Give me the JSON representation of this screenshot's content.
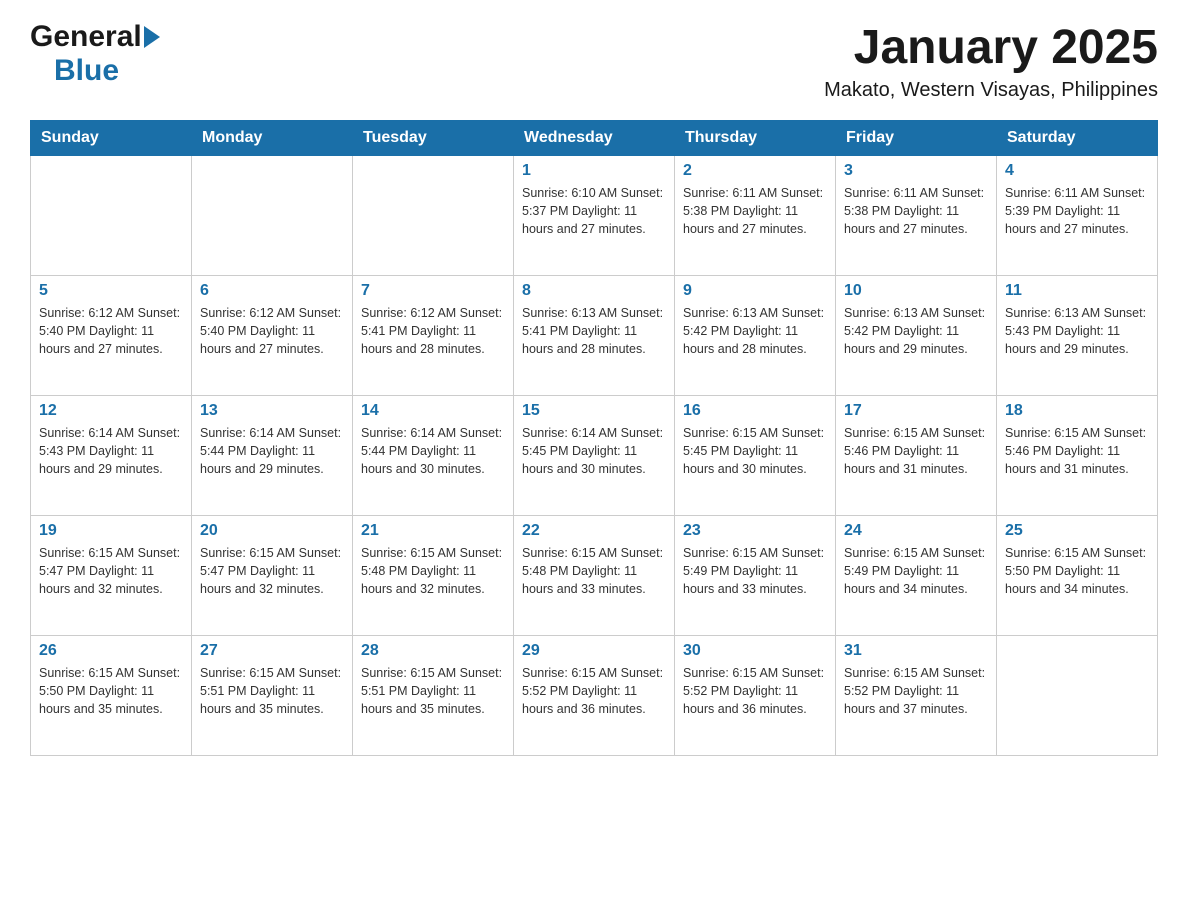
{
  "header": {
    "logo_general": "General",
    "logo_blue": "Blue",
    "month_year": "January 2025",
    "location": "Makato, Western Visayas, Philippines"
  },
  "days_of_week": [
    "Sunday",
    "Monday",
    "Tuesday",
    "Wednesday",
    "Thursday",
    "Friday",
    "Saturday"
  ],
  "weeks": [
    [
      {
        "day": "",
        "info": ""
      },
      {
        "day": "",
        "info": ""
      },
      {
        "day": "",
        "info": ""
      },
      {
        "day": "1",
        "info": "Sunrise: 6:10 AM\nSunset: 5:37 PM\nDaylight: 11 hours\nand 27 minutes."
      },
      {
        "day": "2",
        "info": "Sunrise: 6:11 AM\nSunset: 5:38 PM\nDaylight: 11 hours\nand 27 minutes."
      },
      {
        "day": "3",
        "info": "Sunrise: 6:11 AM\nSunset: 5:38 PM\nDaylight: 11 hours\nand 27 minutes."
      },
      {
        "day": "4",
        "info": "Sunrise: 6:11 AM\nSunset: 5:39 PM\nDaylight: 11 hours\nand 27 minutes."
      }
    ],
    [
      {
        "day": "5",
        "info": "Sunrise: 6:12 AM\nSunset: 5:40 PM\nDaylight: 11 hours\nand 27 minutes."
      },
      {
        "day": "6",
        "info": "Sunrise: 6:12 AM\nSunset: 5:40 PM\nDaylight: 11 hours\nand 27 minutes."
      },
      {
        "day": "7",
        "info": "Sunrise: 6:12 AM\nSunset: 5:41 PM\nDaylight: 11 hours\nand 28 minutes."
      },
      {
        "day": "8",
        "info": "Sunrise: 6:13 AM\nSunset: 5:41 PM\nDaylight: 11 hours\nand 28 minutes."
      },
      {
        "day": "9",
        "info": "Sunrise: 6:13 AM\nSunset: 5:42 PM\nDaylight: 11 hours\nand 28 minutes."
      },
      {
        "day": "10",
        "info": "Sunrise: 6:13 AM\nSunset: 5:42 PM\nDaylight: 11 hours\nand 29 minutes."
      },
      {
        "day": "11",
        "info": "Sunrise: 6:13 AM\nSunset: 5:43 PM\nDaylight: 11 hours\nand 29 minutes."
      }
    ],
    [
      {
        "day": "12",
        "info": "Sunrise: 6:14 AM\nSunset: 5:43 PM\nDaylight: 11 hours\nand 29 minutes."
      },
      {
        "day": "13",
        "info": "Sunrise: 6:14 AM\nSunset: 5:44 PM\nDaylight: 11 hours\nand 29 minutes."
      },
      {
        "day": "14",
        "info": "Sunrise: 6:14 AM\nSunset: 5:44 PM\nDaylight: 11 hours\nand 30 minutes."
      },
      {
        "day": "15",
        "info": "Sunrise: 6:14 AM\nSunset: 5:45 PM\nDaylight: 11 hours\nand 30 minutes."
      },
      {
        "day": "16",
        "info": "Sunrise: 6:15 AM\nSunset: 5:45 PM\nDaylight: 11 hours\nand 30 minutes."
      },
      {
        "day": "17",
        "info": "Sunrise: 6:15 AM\nSunset: 5:46 PM\nDaylight: 11 hours\nand 31 minutes."
      },
      {
        "day": "18",
        "info": "Sunrise: 6:15 AM\nSunset: 5:46 PM\nDaylight: 11 hours\nand 31 minutes."
      }
    ],
    [
      {
        "day": "19",
        "info": "Sunrise: 6:15 AM\nSunset: 5:47 PM\nDaylight: 11 hours\nand 32 minutes."
      },
      {
        "day": "20",
        "info": "Sunrise: 6:15 AM\nSunset: 5:47 PM\nDaylight: 11 hours\nand 32 minutes."
      },
      {
        "day": "21",
        "info": "Sunrise: 6:15 AM\nSunset: 5:48 PM\nDaylight: 11 hours\nand 32 minutes."
      },
      {
        "day": "22",
        "info": "Sunrise: 6:15 AM\nSunset: 5:48 PM\nDaylight: 11 hours\nand 33 minutes."
      },
      {
        "day": "23",
        "info": "Sunrise: 6:15 AM\nSunset: 5:49 PM\nDaylight: 11 hours\nand 33 minutes."
      },
      {
        "day": "24",
        "info": "Sunrise: 6:15 AM\nSunset: 5:49 PM\nDaylight: 11 hours\nand 34 minutes."
      },
      {
        "day": "25",
        "info": "Sunrise: 6:15 AM\nSunset: 5:50 PM\nDaylight: 11 hours\nand 34 minutes."
      }
    ],
    [
      {
        "day": "26",
        "info": "Sunrise: 6:15 AM\nSunset: 5:50 PM\nDaylight: 11 hours\nand 35 minutes."
      },
      {
        "day": "27",
        "info": "Sunrise: 6:15 AM\nSunset: 5:51 PM\nDaylight: 11 hours\nand 35 minutes."
      },
      {
        "day": "28",
        "info": "Sunrise: 6:15 AM\nSunset: 5:51 PM\nDaylight: 11 hours\nand 35 minutes."
      },
      {
        "day": "29",
        "info": "Sunrise: 6:15 AM\nSunset: 5:52 PM\nDaylight: 11 hours\nand 36 minutes."
      },
      {
        "day": "30",
        "info": "Sunrise: 6:15 AM\nSunset: 5:52 PM\nDaylight: 11 hours\nand 36 minutes."
      },
      {
        "day": "31",
        "info": "Sunrise: 6:15 AM\nSunset: 5:52 PM\nDaylight: 11 hours\nand 37 minutes."
      },
      {
        "day": "",
        "info": ""
      }
    ]
  ]
}
